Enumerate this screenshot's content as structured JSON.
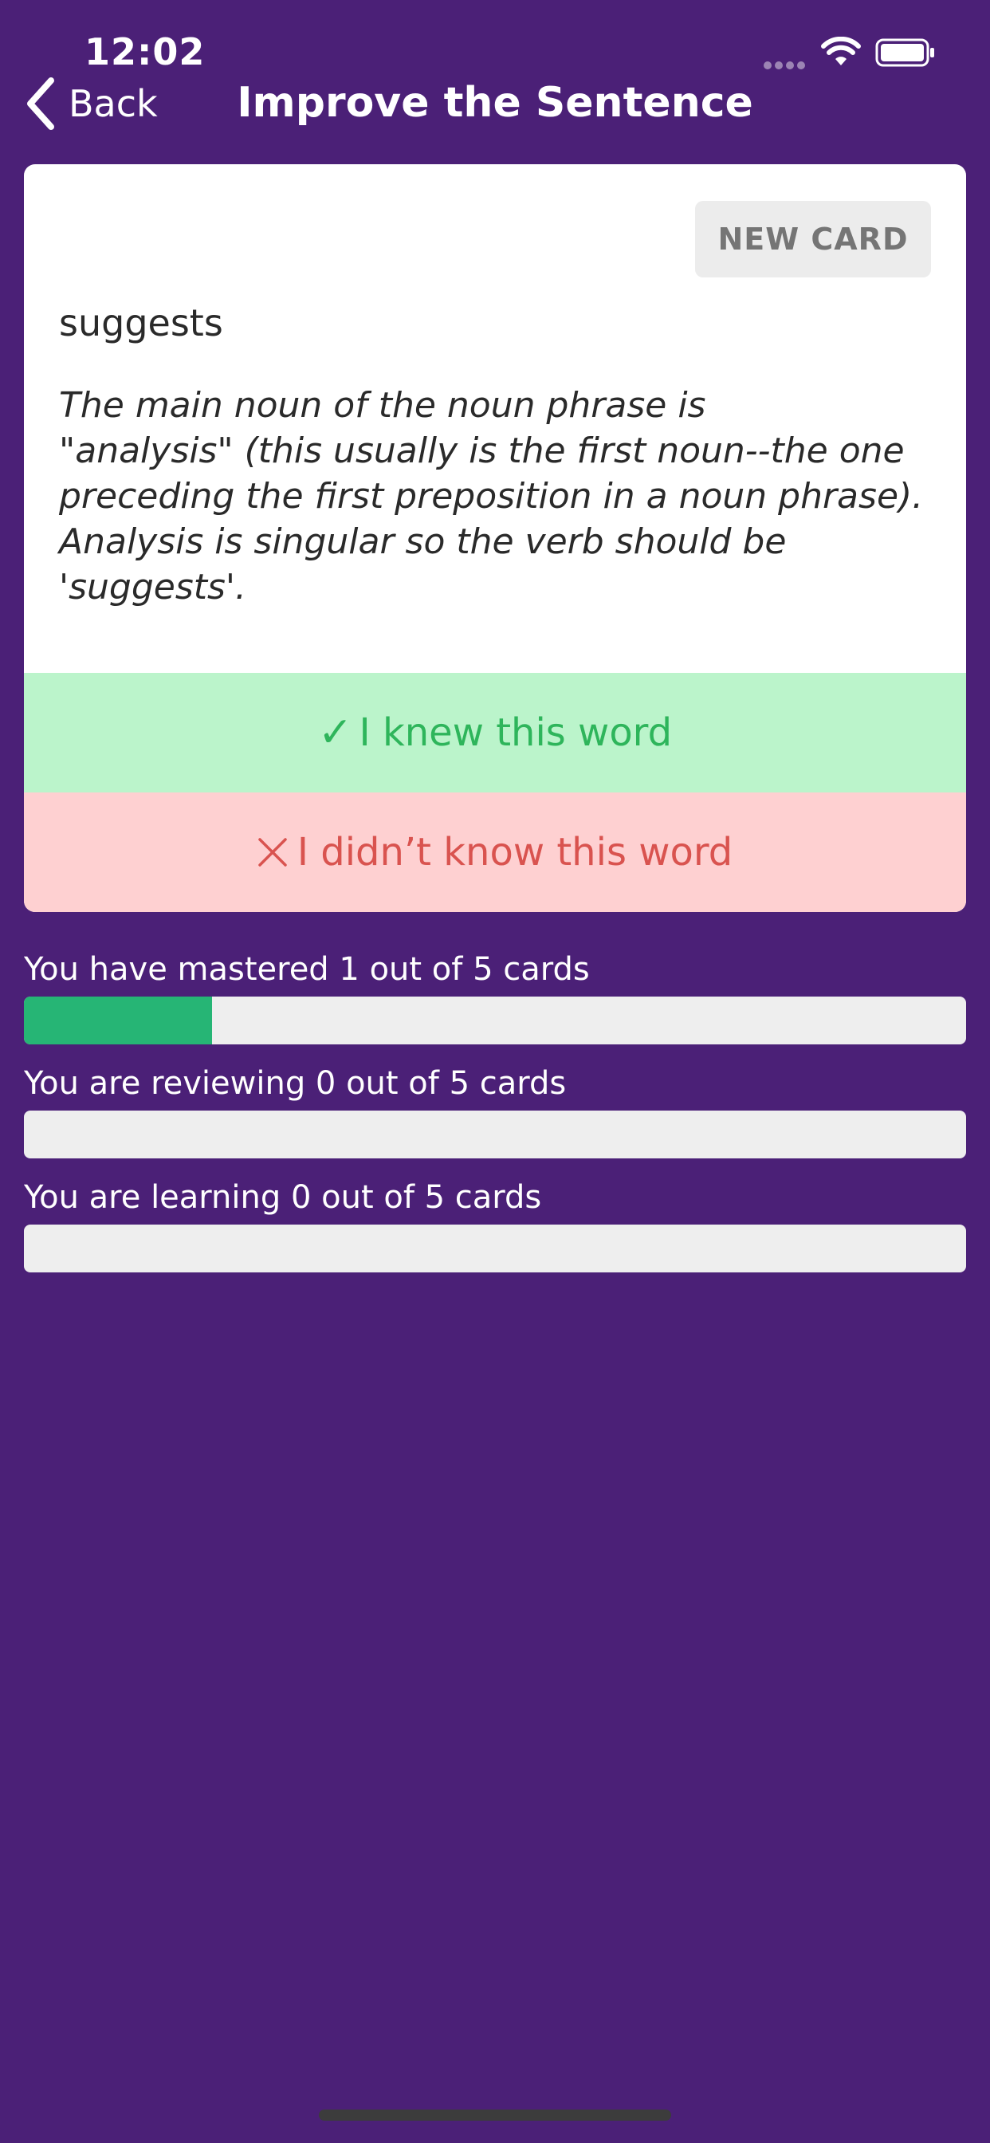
{
  "status_bar": {
    "time": "12:02"
  },
  "nav": {
    "back_label": "Back",
    "title": "Improve the Sentence"
  },
  "card": {
    "new_card_label": "NEW CARD",
    "word": "suggests",
    "explanation": "The main noun of the noun phrase is\n\"analysis\" (this usually is the first noun--the one\npreceding the first preposition in a noun phrase).\nAnalysis is singular so the verb should be\n'suggests'.",
    "knew_icon": "✓",
    "knew_label": "I knew this word",
    "didnt_label": "I didn’t know this word"
  },
  "progress": {
    "mastered": {
      "label": "You have mastered 1 out of 5 cards",
      "fraction": 0.2
    },
    "reviewing": {
      "label": "You are reviewing 0 out of 5 cards",
      "fraction": 0
    },
    "learning": {
      "label": "You are learning 0 out of 5 cards",
      "fraction": 0
    }
  },
  "colors": {
    "background": "#4b2077",
    "knew": "#2eb55b",
    "didnt": "#d9534f",
    "progress_fill": "#26b575"
  },
  "icons": {
    "back": "chevron-left-icon",
    "wifi": "wifi-icon",
    "battery": "battery-icon",
    "knew": "checkmark-icon",
    "didnt": "x-icon"
  }
}
